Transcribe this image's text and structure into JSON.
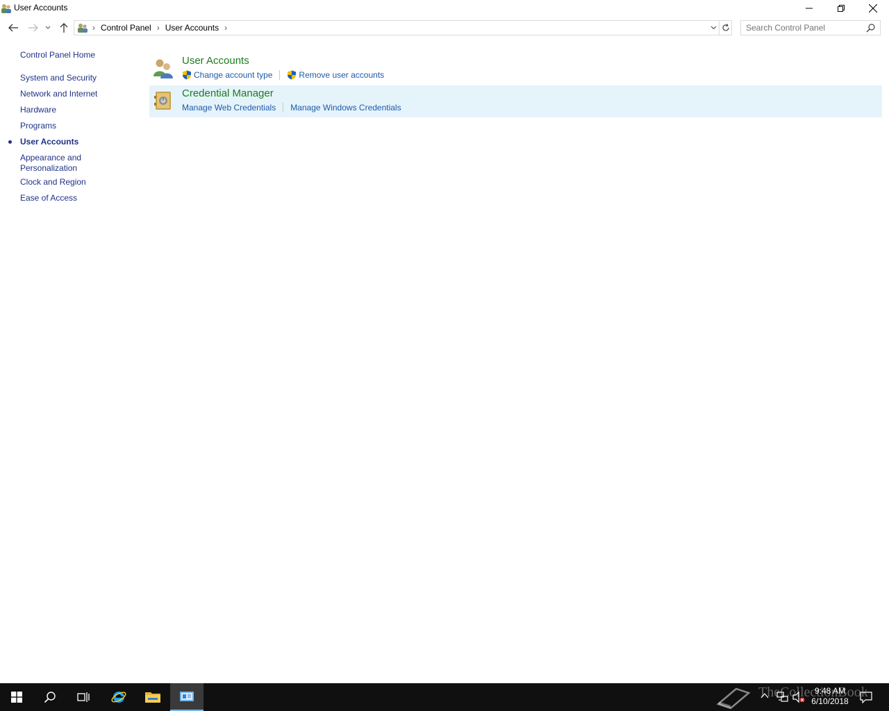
{
  "window": {
    "title": "User Accounts"
  },
  "addressbar": {
    "crumbs": [
      "Control Panel",
      "User Accounts"
    ]
  },
  "search": {
    "placeholder": "Search Control Panel"
  },
  "leftnav": {
    "home": "Control Panel Home",
    "items": [
      {
        "label": "System and Security"
      },
      {
        "label": "Network and Internet"
      },
      {
        "label": "Hardware"
      },
      {
        "label": "Programs"
      },
      {
        "label": "User Accounts",
        "active": true
      },
      {
        "label": "Appearance and Personalization"
      },
      {
        "label": "Clock and Region"
      },
      {
        "label": "Ease of Access"
      }
    ]
  },
  "categories": [
    {
      "title": "User Accounts",
      "links": [
        "Change account type",
        "Remove user accounts"
      ]
    },
    {
      "title": "Credential Manager",
      "links": [
        "Manage Web Credentials",
        "Manage Windows Credentials"
      ]
    }
  ],
  "taskbar": {
    "time": "9:48 AM",
    "date": "6/10/2018"
  },
  "watermark": {
    "text": "TheCollectionBook"
  },
  "colors": {
    "link": "#1e5aa8",
    "category_title": "#1b7c1b",
    "nav_link": "#1e3287",
    "hover_row": "#e5f3fb",
    "taskbar": "#101010"
  }
}
